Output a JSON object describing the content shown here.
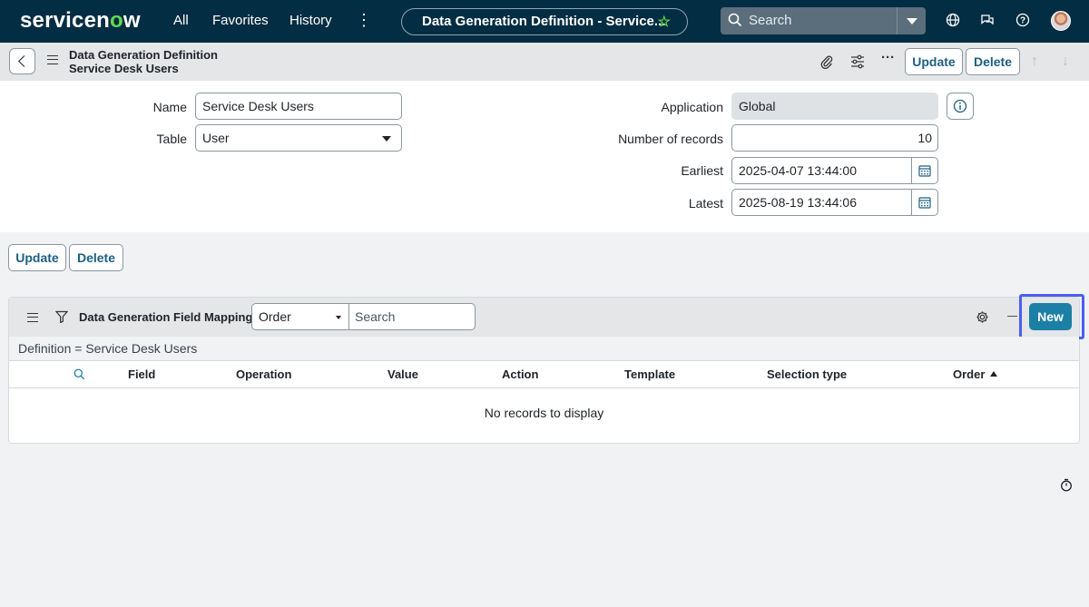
{
  "topnav": {
    "logo_text": "servicenow",
    "links": [
      "All",
      "Favorites",
      "History"
    ],
    "more_icon": "kebab-icon",
    "context_pill": "Data Generation Definition - Service...",
    "search_placeholder": "Search"
  },
  "record": {
    "title_line1": "Data Generation Definition",
    "title_line2": "Service Desk Users",
    "update_label": "Update",
    "delete_label": "Delete"
  },
  "form": {
    "name_label": "Name",
    "name_value": "Service Desk Users",
    "table_label": "Table",
    "table_value": "User",
    "application_label": "Application",
    "application_value": "Global",
    "records_label": "Number of records",
    "records_value": "10",
    "earliest_label": "Earliest",
    "earliest_value": "2025-04-07 13:44:00",
    "latest_label": "Latest",
    "latest_value": "2025-08-19 13:44:06"
  },
  "actions": {
    "update_label": "Update",
    "delete_label": "Delete"
  },
  "related_list": {
    "title": "Data Generation Field Mappings",
    "order_select": "Order",
    "search_placeholder": "Search",
    "new_label": "New",
    "filter_text": "Definition = Service Desk Users",
    "columns": [
      "Field",
      "Operation",
      "Value",
      "Action",
      "Template",
      "Selection type",
      "Order"
    ],
    "empty_text": "No records to display"
  },
  "colors": {
    "nav_bg": "#032d42",
    "accent": "#1c7fa6",
    "highlight": "#4b5ef0",
    "logo_green": "#62d84e"
  }
}
